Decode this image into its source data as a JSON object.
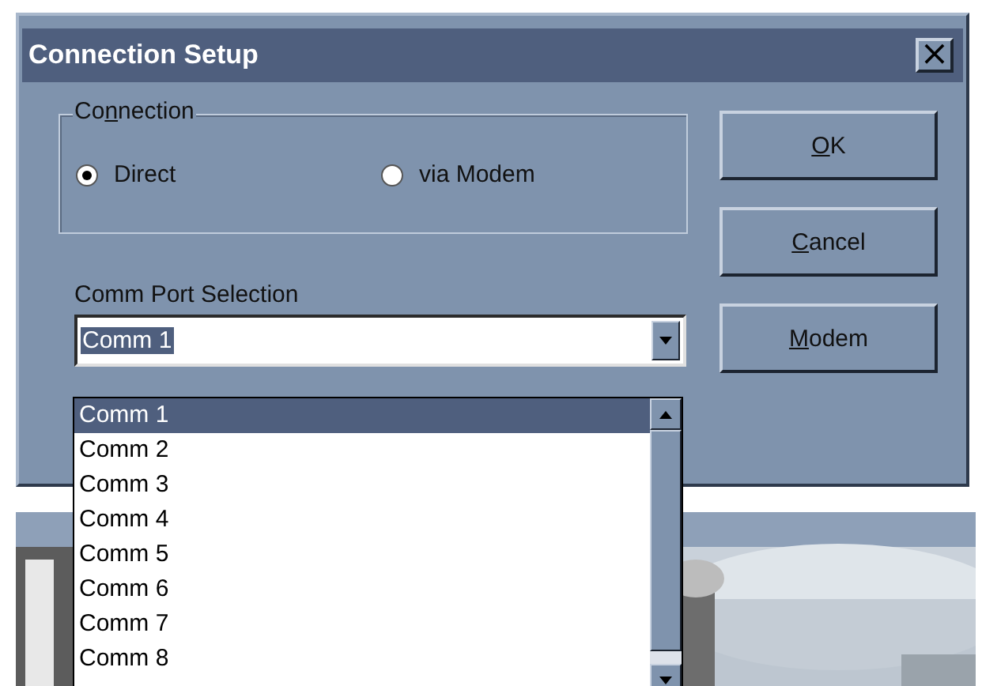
{
  "window": {
    "title": "Connection Setup",
    "close_glyph": "×"
  },
  "connection_group": {
    "label": {
      "before": "Co",
      "key": "n",
      "after": "nection"
    },
    "options": [
      {
        "label": "Direct",
        "selected": true
      },
      {
        "label": "via Modem",
        "selected": false
      }
    ]
  },
  "buttons": [
    {
      "label": {
        "key": "O",
        "after": "K"
      }
    },
    {
      "label": {
        "key": "C",
        "after": "ancel"
      }
    },
    {
      "label": {
        "key": "M",
        "after": "odem"
      }
    }
  ],
  "comm_port": {
    "label": "Comm Port Selection",
    "value": "Comm 1",
    "expanded": true,
    "items": [
      {
        "label": "Comm 1",
        "selected": true
      },
      {
        "label": "Comm 2",
        "selected": false
      },
      {
        "label": "Comm 3",
        "selected": false
      },
      {
        "label": "Comm 4",
        "selected": false
      },
      {
        "label": "Comm 5",
        "selected": false
      },
      {
        "label": "Comm 6",
        "selected": false
      },
      {
        "label": "Comm 7",
        "selected": false
      },
      {
        "label": "Comm 8",
        "selected": false
      }
    ]
  }
}
